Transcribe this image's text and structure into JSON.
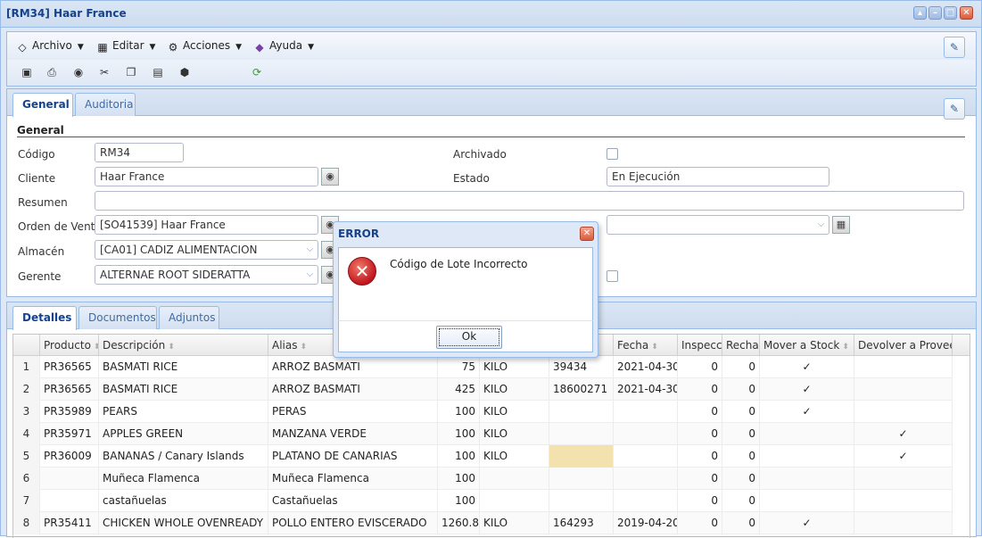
{
  "window": {
    "title": "[RM34] Haar France"
  },
  "menu": {
    "items": [
      {
        "label": "Archivo",
        "icon": "archive-icon"
      },
      {
        "label": "Editar",
        "icon": "edit-icon"
      },
      {
        "label": "Acciones",
        "icon": "actions-icon"
      },
      {
        "label": "Ayuda",
        "icon": "help-icon"
      }
    ]
  },
  "tabs_top": [
    {
      "label": "General"
    },
    {
      "label": "Auditoria"
    }
  ],
  "form": {
    "section_title": "General",
    "codigo": {
      "label": "Código",
      "value": "RM34"
    },
    "archivado": {
      "label": "Archivado"
    },
    "cliente": {
      "label": "Cliente",
      "value": "Haar France"
    },
    "estado": {
      "label": "Estado",
      "value": "En Ejecución"
    },
    "resumen": {
      "label": "Resumen",
      "value": ""
    },
    "orden_venta": {
      "label": "Orden de Venta",
      "value": "[SO41539] Haar France"
    },
    "almacen": {
      "label": "Almacén",
      "value": "[CA01] CADIZ ALIMENTACION"
    },
    "gerente": {
      "label": "Gerente",
      "value": "ALTERNAE ROOT SIDERATTA"
    },
    "right_combo": {
      "value": ""
    }
  },
  "tabs_bottom": [
    {
      "label": "Detalles"
    },
    {
      "label": "Documentos"
    },
    {
      "label": "Adjuntos"
    }
  ],
  "grid": {
    "columns": [
      "Producto",
      "Descripción",
      "Alias",
      "",
      "",
      "",
      "Fecha",
      "Inspecci",
      "Rechaz",
      "Mover a Stock",
      "Devolver a Proveed"
    ],
    "rows": [
      {
        "n": "1",
        "producto": "PR36565",
        "descripcion": "BASMATI RICE",
        "alias": "ARROZ BASMATI",
        "cantidad": "75",
        "unidad": "KILO",
        "lote": "39434",
        "fecha": "2021-04-30",
        "insp": "0",
        "rech": "0",
        "stock": "✓",
        "devolver": ""
      },
      {
        "n": "2",
        "producto": "PR36565",
        "descripcion": "BASMATI RICE",
        "alias": "ARROZ BASMATI",
        "cantidad": "425",
        "unidad": "KILO",
        "lote": "18600271",
        "fecha": "2021-04-30",
        "insp": "0",
        "rech": "0",
        "stock": "✓",
        "devolver": ""
      },
      {
        "n": "3",
        "producto": "PR35989",
        "descripcion": "PEARS",
        "alias": "PERAS",
        "cantidad": "100",
        "unidad": "KILO",
        "lote": "",
        "fecha": "",
        "insp": "0",
        "rech": "0",
        "stock": "✓",
        "devolver": ""
      },
      {
        "n": "4",
        "producto": "PR35971",
        "descripcion": "APPLES GREEN",
        "alias": "MANZANA VERDE",
        "cantidad": "100",
        "unidad": "KILO",
        "lote": "",
        "fecha": "",
        "insp": "0",
        "rech": "0",
        "stock": "",
        "devolver": "✓"
      },
      {
        "n": "5",
        "producto": "PR36009",
        "descripcion": "BANANAS / Canary Islands",
        "alias": "PLATANO DE CANARIAS",
        "cantidad": "100",
        "unidad": "KILO",
        "lote": "",
        "fecha": "",
        "insp": "0",
        "rech": "0",
        "stock": "",
        "devolver": "✓"
      },
      {
        "n": "6",
        "producto": "",
        "descripcion": "Muñeca Flamenca",
        "alias": "Muñeca Flamenca",
        "cantidad": "100",
        "unidad": "",
        "lote": "",
        "fecha": "",
        "insp": "0",
        "rech": "0",
        "stock": "",
        "devolver": ""
      },
      {
        "n": "7",
        "producto": "",
        "descripcion": "castañuelas",
        "alias": "Castañuelas",
        "cantidad": "100",
        "unidad": "",
        "lote": "",
        "fecha": "",
        "insp": "0",
        "rech": "0",
        "stock": "",
        "devolver": ""
      },
      {
        "n": "8",
        "producto": "PR35411",
        "descripcion": "CHICKEN WHOLE OVENREADY",
        "alias": "POLLO ENTERO EVISCERADO",
        "cantidad": "1260.8",
        "unidad": "KILO",
        "lote": "164293",
        "fecha": "2019-04-20",
        "insp": "0",
        "rech": "0",
        "stock": "✓",
        "devolver": ""
      }
    ]
  },
  "dialog": {
    "title": "ERROR",
    "message": "Código de Lote Incorrecto",
    "ok_label": "Ok",
    "icon": "error-icon"
  },
  "colors": {
    "title": "#15428b",
    "border": "#99bbe8",
    "highlight_cell": "#f3e2ae"
  }
}
